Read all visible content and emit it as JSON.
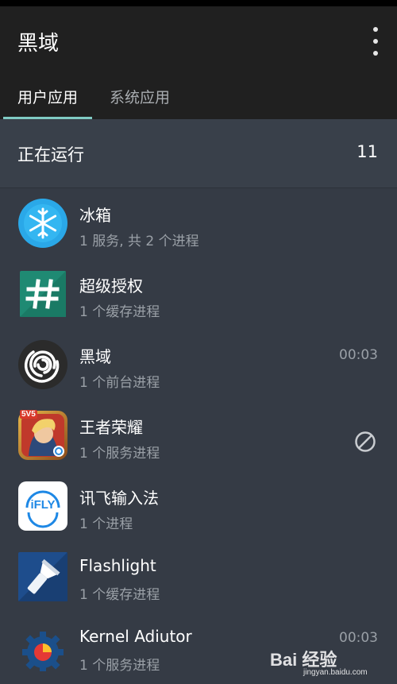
{
  "app": {
    "title": "黑域"
  },
  "tabs": [
    {
      "label": "用户应用",
      "active": true
    },
    {
      "label": "系统应用",
      "active": false
    }
  ],
  "section": {
    "title": "正在运行",
    "count": "11"
  },
  "apps": [
    {
      "name": "冰箱",
      "detail": "1 服务, 共 2 个进程",
      "time": "",
      "icon": "snowflake-icon",
      "blocked": false
    },
    {
      "name": "超级授权",
      "detail": "1 个缓存进程",
      "time": "",
      "icon": "hash-icon",
      "blocked": false
    },
    {
      "name": "黑域",
      "detail": "1 个前台进程",
      "time": "00:03",
      "icon": "spiral-icon",
      "blocked": false
    },
    {
      "name": "王者荣耀",
      "detail": "1 个服务进程",
      "time": "",
      "icon": "game-icon",
      "blocked": true
    },
    {
      "name": "讯飞输入法",
      "detail": "1 个进程",
      "time": "",
      "icon": "ifly-icon",
      "blocked": false
    },
    {
      "name": "Flashlight",
      "detail": "1 个缓存进程",
      "time": "",
      "icon": "flashlight-icon",
      "blocked": false
    },
    {
      "name": "Kernel Adiutor",
      "detail": "1 个服务进程",
      "time": "00:03",
      "icon": "gear-icon",
      "blocked": false
    }
  ],
  "icons": {
    "ifly_text": "iFLY",
    "game_badge": "5V5"
  },
  "watermark": {
    "brand": "Bai 经验",
    "sub": "jingyan.baidu.com"
  },
  "colors": {
    "tab_indicator": "#80cbc4",
    "background": "#353b45",
    "appbar": "#202020"
  }
}
